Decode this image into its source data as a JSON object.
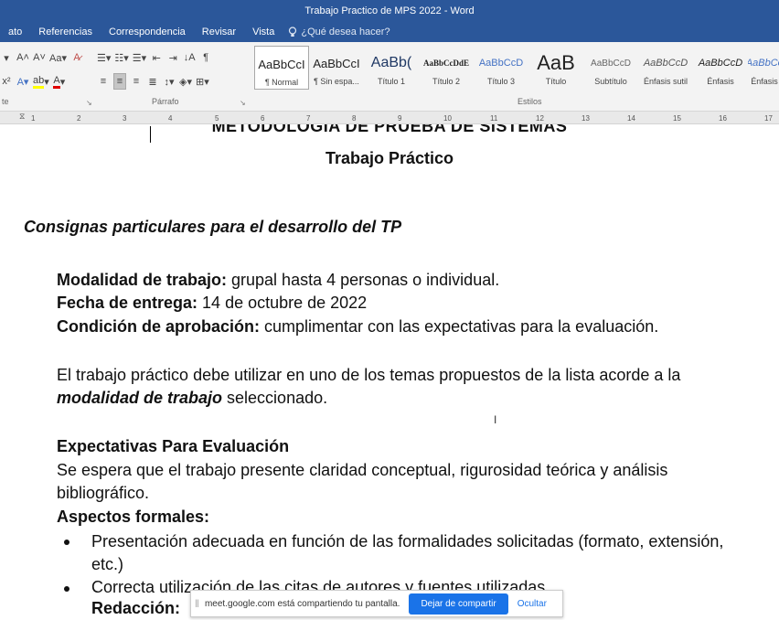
{
  "window": {
    "title": "Trabajo Practico de MPS 2022 - Word"
  },
  "menu": {
    "items": [
      "ato",
      "Referencias",
      "Correspondencia",
      "Revisar",
      "Vista"
    ],
    "tell_me": "¿Qué desea hacer?"
  },
  "ribbon": {
    "groups": {
      "fuente": "te",
      "parrafo": "Párrafo",
      "estilos": "Estilos"
    },
    "styles": [
      {
        "sample": "AaBbCcI",
        "name": "¶ Normal"
      },
      {
        "sample": "AaBbCcI",
        "name": "¶ Sin espa..."
      },
      {
        "sample": "AaBb(",
        "name": "Título 1"
      },
      {
        "sample": "AaBbCcDdE",
        "name": "Título 2"
      },
      {
        "sample": "AaBbCcD",
        "name": "Título 3"
      },
      {
        "sample": "AaB",
        "name": "Título"
      },
      {
        "sample": "AaBbCcD",
        "name": "Subtítulo"
      },
      {
        "sample": "AaBbCcD",
        "name": "Énfasis sutil"
      },
      {
        "sample": "AaBbCcD",
        "name": "Énfasis"
      },
      {
        "sample": "AaBbCc",
        "name": "Énfasis"
      }
    ]
  },
  "ruler": {
    "ticks": [
      "1",
      "2",
      "3",
      "4",
      "5",
      "6",
      "7",
      "8",
      "9",
      "10",
      "11",
      "12",
      "13",
      "14",
      "15",
      "16",
      "17"
    ]
  },
  "document": {
    "title_line1": "METODOLOGÍA DE PRUEBA DE SISTEMAS",
    "title_line2": "Trabajo Práctico",
    "consignas_heading": "Consignas particulares para el desarrollo del TP",
    "modalidad_label": "Modalidad de trabajo:",
    "modalidad_value": " grupal hasta 4 personas o individual.",
    "fecha_label": "Fecha de entrega:",
    "fecha_value": " 14 de octubre de 2022",
    "condicion_label": "Condición de aprobación:",
    "condicion_value": " cumplimentar con las expectativas para la evaluación.",
    "intro_line1": "El trabajo práctico debe utilizar en uno de los temas propuestos de la lista acorde a la",
    "intro_emph": "modalidad de trabajo",
    "intro_rest": " seleccionado.",
    "expectativas_heading": "Expectativas Para Evaluación",
    "expectativas_line1": "Se espera que el trabajo presente claridad conceptual, rigurosidad teórica y análisis",
    "expectativas_line2": "bibliográfico.",
    "aspectos_heading": "Aspectos formales:",
    "bullet1_line1": "Presentación adecuada en función de las formalidades solicitadas (formato, extensión,",
    "bullet1_line2": "etc.)",
    "bullet2": "Correcta utilización de las citas de autores y fuentes utilizadas.",
    "redaccion_partial": "Redacción:"
  },
  "share_bar": {
    "message": "meet.google.com está compartiendo tu pantalla.",
    "stop_label": "Dejar de compartir",
    "hide_label": "Ocultar"
  }
}
